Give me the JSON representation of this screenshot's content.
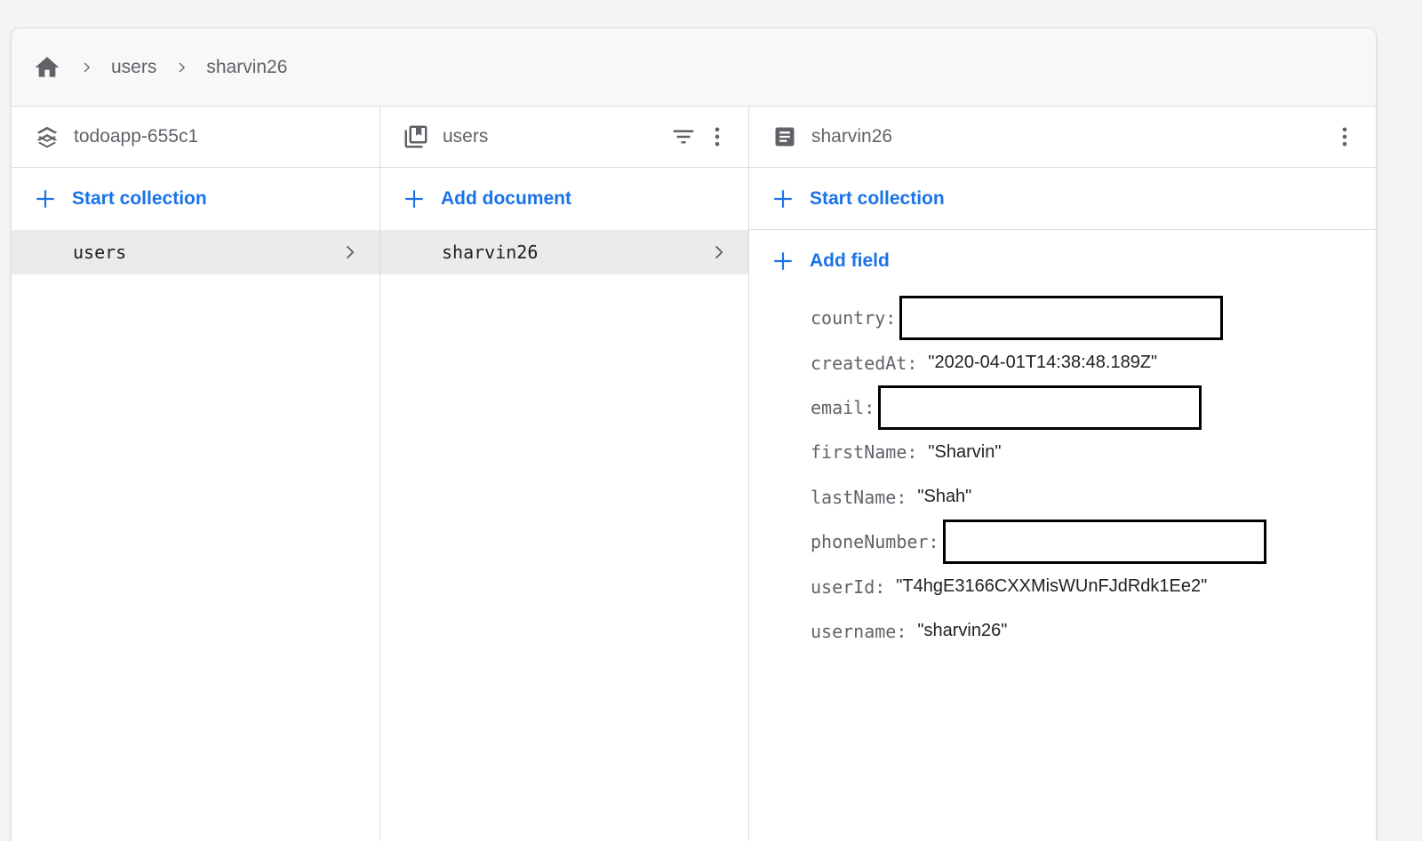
{
  "breadcrumb": {
    "items": [
      "users",
      "sharvin26"
    ]
  },
  "columns": {
    "root": {
      "title": "todoapp-655c1",
      "action_label": "Start collection",
      "items": [
        {
          "label": "users"
        }
      ]
    },
    "collection": {
      "title": "users",
      "action_label": "Add document",
      "items": [
        {
          "label": "sharvin26"
        }
      ]
    },
    "document": {
      "title": "sharvin26",
      "start_collection_label": "Start collection",
      "add_field_label": "Add field",
      "fields": [
        {
          "key": "country",
          "value": ""
        },
        {
          "key": "createdAt",
          "value": "\"2020-04-01T14:38:48.189Z\""
        },
        {
          "key": "email",
          "value": ""
        },
        {
          "key": "firstName",
          "value": "\"Sharvin\""
        },
        {
          "key": "lastName",
          "value": "\"Shah\""
        },
        {
          "key": "phoneNumber",
          "value": ""
        },
        {
          "key": "userId",
          "value": "\"T4hgE3166CXXMisWUnFJdRdk1Ee2\""
        },
        {
          "key": "username",
          "value": "\"sharvin26\""
        }
      ]
    }
  },
  "colors": {
    "accent": "#1a73e8",
    "selected_row": "#ebebeb",
    "muted_text": "#5f6368"
  },
  "icons": {
    "home": "home-icon",
    "project": "firestore-layers-icon",
    "collection": "collection-icon",
    "document": "document-icon",
    "filter": "filter-icon",
    "more": "more-vert-icon",
    "add": "plus-icon",
    "chevron": "chevron-right-icon"
  }
}
